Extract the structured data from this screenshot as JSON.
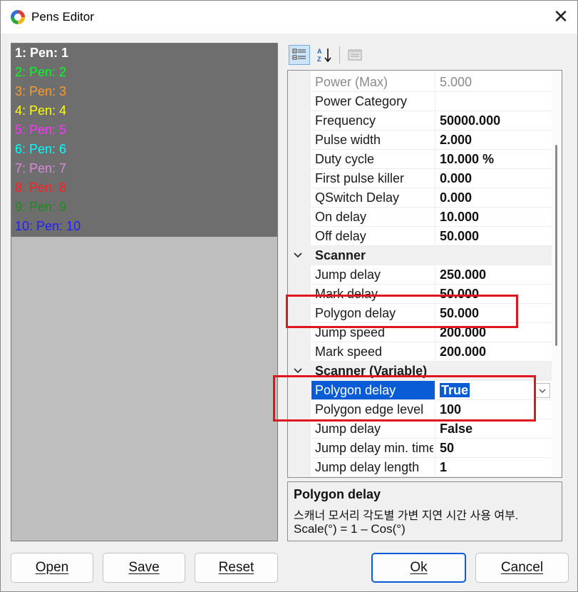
{
  "window": {
    "title": "Pens Editor",
    "close_glyph": "✕"
  },
  "pens": [
    {
      "label": "1: Pen: 1",
      "color": "#ffffff",
      "bold": true
    },
    {
      "label": "2: Pen: 2",
      "color": "#00ff22"
    },
    {
      "label": "3: Pen: 3",
      "color": "#ff9a2e"
    },
    {
      "label": "4: Pen: 4",
      "color": "#ffff00"
    },
    {
      "label": "5: Pen: 5",
      "color": "#ff33ff"
    },
    {
      "label": "6: Pen: 6",
      "color": "#00ffff"
    },
    {
      "label": "7: Pen: 7",
      "color": "#d98ad9"
    },
    {
      "label": "8: Pen: 8",
      "color": "#ff2020"
    },
    {
      "label": "9: Pen: 9",
      "color": "#1f8a1f"
    },
    {
      "label": "10: Pen: 10",
      "color": "#1f1fff"
    }
  ],
  "toolbar": {
    "categorized_icon": "categorized-view-icon",
    "alphabetical_icon": "alphabetical-sort-icon",
    "property_pages_icon": "property-pages-icon"
  },
  "grid": {
    "rows": [
      {
        "name": "Power (Max)",
        "value": "5.000",
        "kind": "disabled"
      },
      {
        "name": "Power Category",
        "value": "",
        "kind": "normal"
      },
      {
        "name": "Frequency",
        "value": "50000.000",
        "kind": "normal"
      },
      {
        "name": "Pulse width",
        "value": "2.000",
        "kind": "normal"
      },
      {
        "name": "Duty cycle",
        "value": "10.000 %",
        "kind": "normal"
      },
      {
        "name": "First pulse killer",
        "value": "0.000",
        "kind": "normal"
      },
      {
        "name": "QSwitch Delay",
        "value": "0.000",
        "kind": "normal"
      },
      {
        "name": "On delay",
        "value": "10.000",
        "kind": "normal"
      },
      {
        "name": "Off delay",
        "value": "50.000",
        "kind": "normal"
      },
      {
        "name": "Scanner",
        "value": "",
        "kind": "category"
      },
      {
        "name": "Jump delay",
        "value": "250.000",
        "kind": "normal"
      },
      {
        "name": "Mark delay",
        "value": "50.000",
        "kind": "normal"
      },
      {
        "name": "Polygon delay",
        "value": "50.000",
        "kind": "normal"
      },
      {
        "name": "Jump speed",
        "value": "200.000",
        "kind": "normal"
      },
      {
        "name": "Mark speed",
        "value": "200.000",
        "kind": "normal"
      },
      {
        "name": "Scanner (Variable)",
        "value": "",
        "kind": "category"
      },
      {
        "name": "Polygon delay",
        "value": "True",
        "kind": "selected"
      },
      {
        "name": "Polygon edge level",
        "value": "100",
        "kind": "normal"
      },
      {
        "name": "Jump delay",
        "value": "False",
        "kind": "normal"
      },
      {
        "name": "Jump delay min. time",
        "value": "50",
        "kind": "normal"
      },
      {
        "name": "Jump delay length",
        "value": "1",
        "kind": "normal"
      }
    ]
  },
  "description": {
    "title": "Polygon delay",
    "line1": "스캐너 모서리 각도별 가변 지연 시간 사용 여부.",
    "line2": "Scale(°) = 1 – Cos(°)"
  },
  "buttons": {
    "open": "Open",
    "save": "Save",
    "reset": "Reset",
    "ok": "Ok",
    "cancel": "Cancel"
  },
  "colors": {
    "selection": "#0a5cd6",
    "highlight_box": "#e0161e"
  }
}
